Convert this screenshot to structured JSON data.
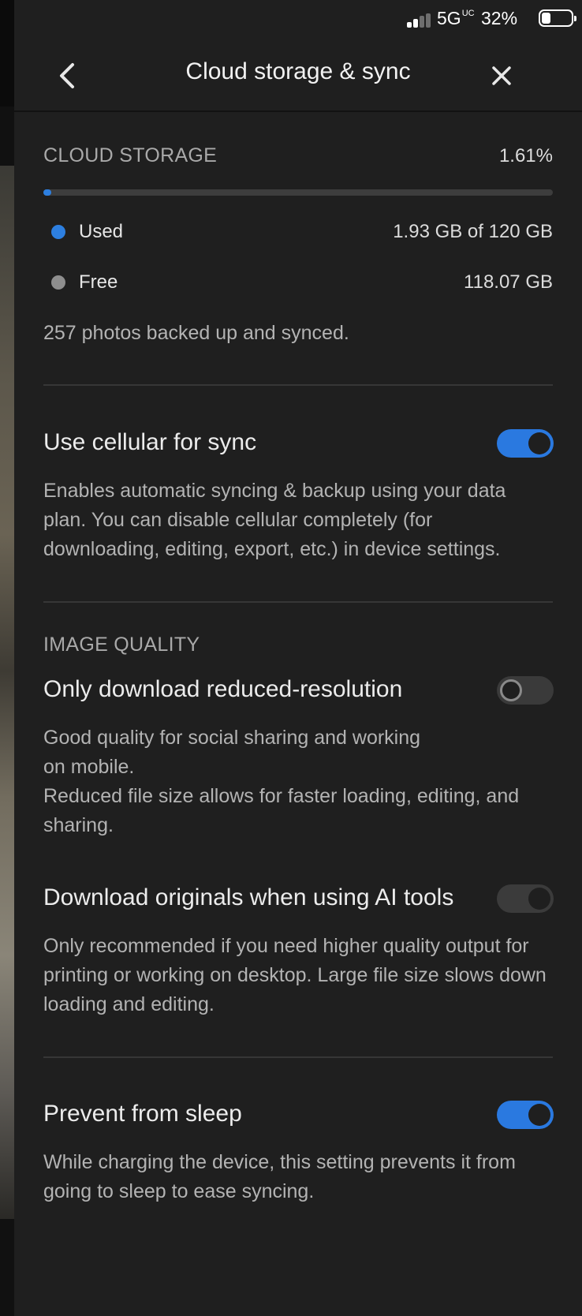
{
  "status_bar": {
    "network": "5G",
    "network_sup": "UC",
    "battery_percent": "32%",
    "battery_level": 0.32
  },
  "header": {
    "title": "Cloud storage & sync"
  },
  "cloud_storage": {
    "label": "CLOUD STORAGE",
    "percent_text": "1.61%",
    "percent_value": 1.61,
    "used_label": "Used",
    "used_value": "1.93 GB of 120 GB",
    "used_color": "#2d7fe0",
    "free_label": "Free",
    "free_value": "118.07 GB",
    "free_color": "#8e8e8e",
    "summary": "257 photos backed up and synced."
  },
  "cellular": {
    "title": "Use cellular for sync",
    "enabled": true,
    "description": "Enables automatic syncing & backup using your data plan. You can disable cellular completely (for downloading, editing, export, etc.) in device settings."
  },
  "image_quality": {
    "label": "IMAGE QUALITY",
    "reduced": {
      "title": "Only download reduced-resolution",
      "enabled": false,
      "description_line1": "Good quality for social sharing and working",
      "description_line2": "on mobile.",
      "description_line3": "Reduced file size allows for faster loading, editing, and sharing."
    },
    "originals": {
      "title": "Download originals when using AI tools",
      "enabled": true,
      "disabled_state": true,
      "description": "Only recommended if you need higher quality output for printing or working on desktop. Large file size slows down loading and editing."
    }
  },
  "sleep": {
    "title": "Prevent from sleep",
    "enabled": true,
    "description": "While charging the device, this setting prevents it from going to sleep to ease syncing."
  }
}
